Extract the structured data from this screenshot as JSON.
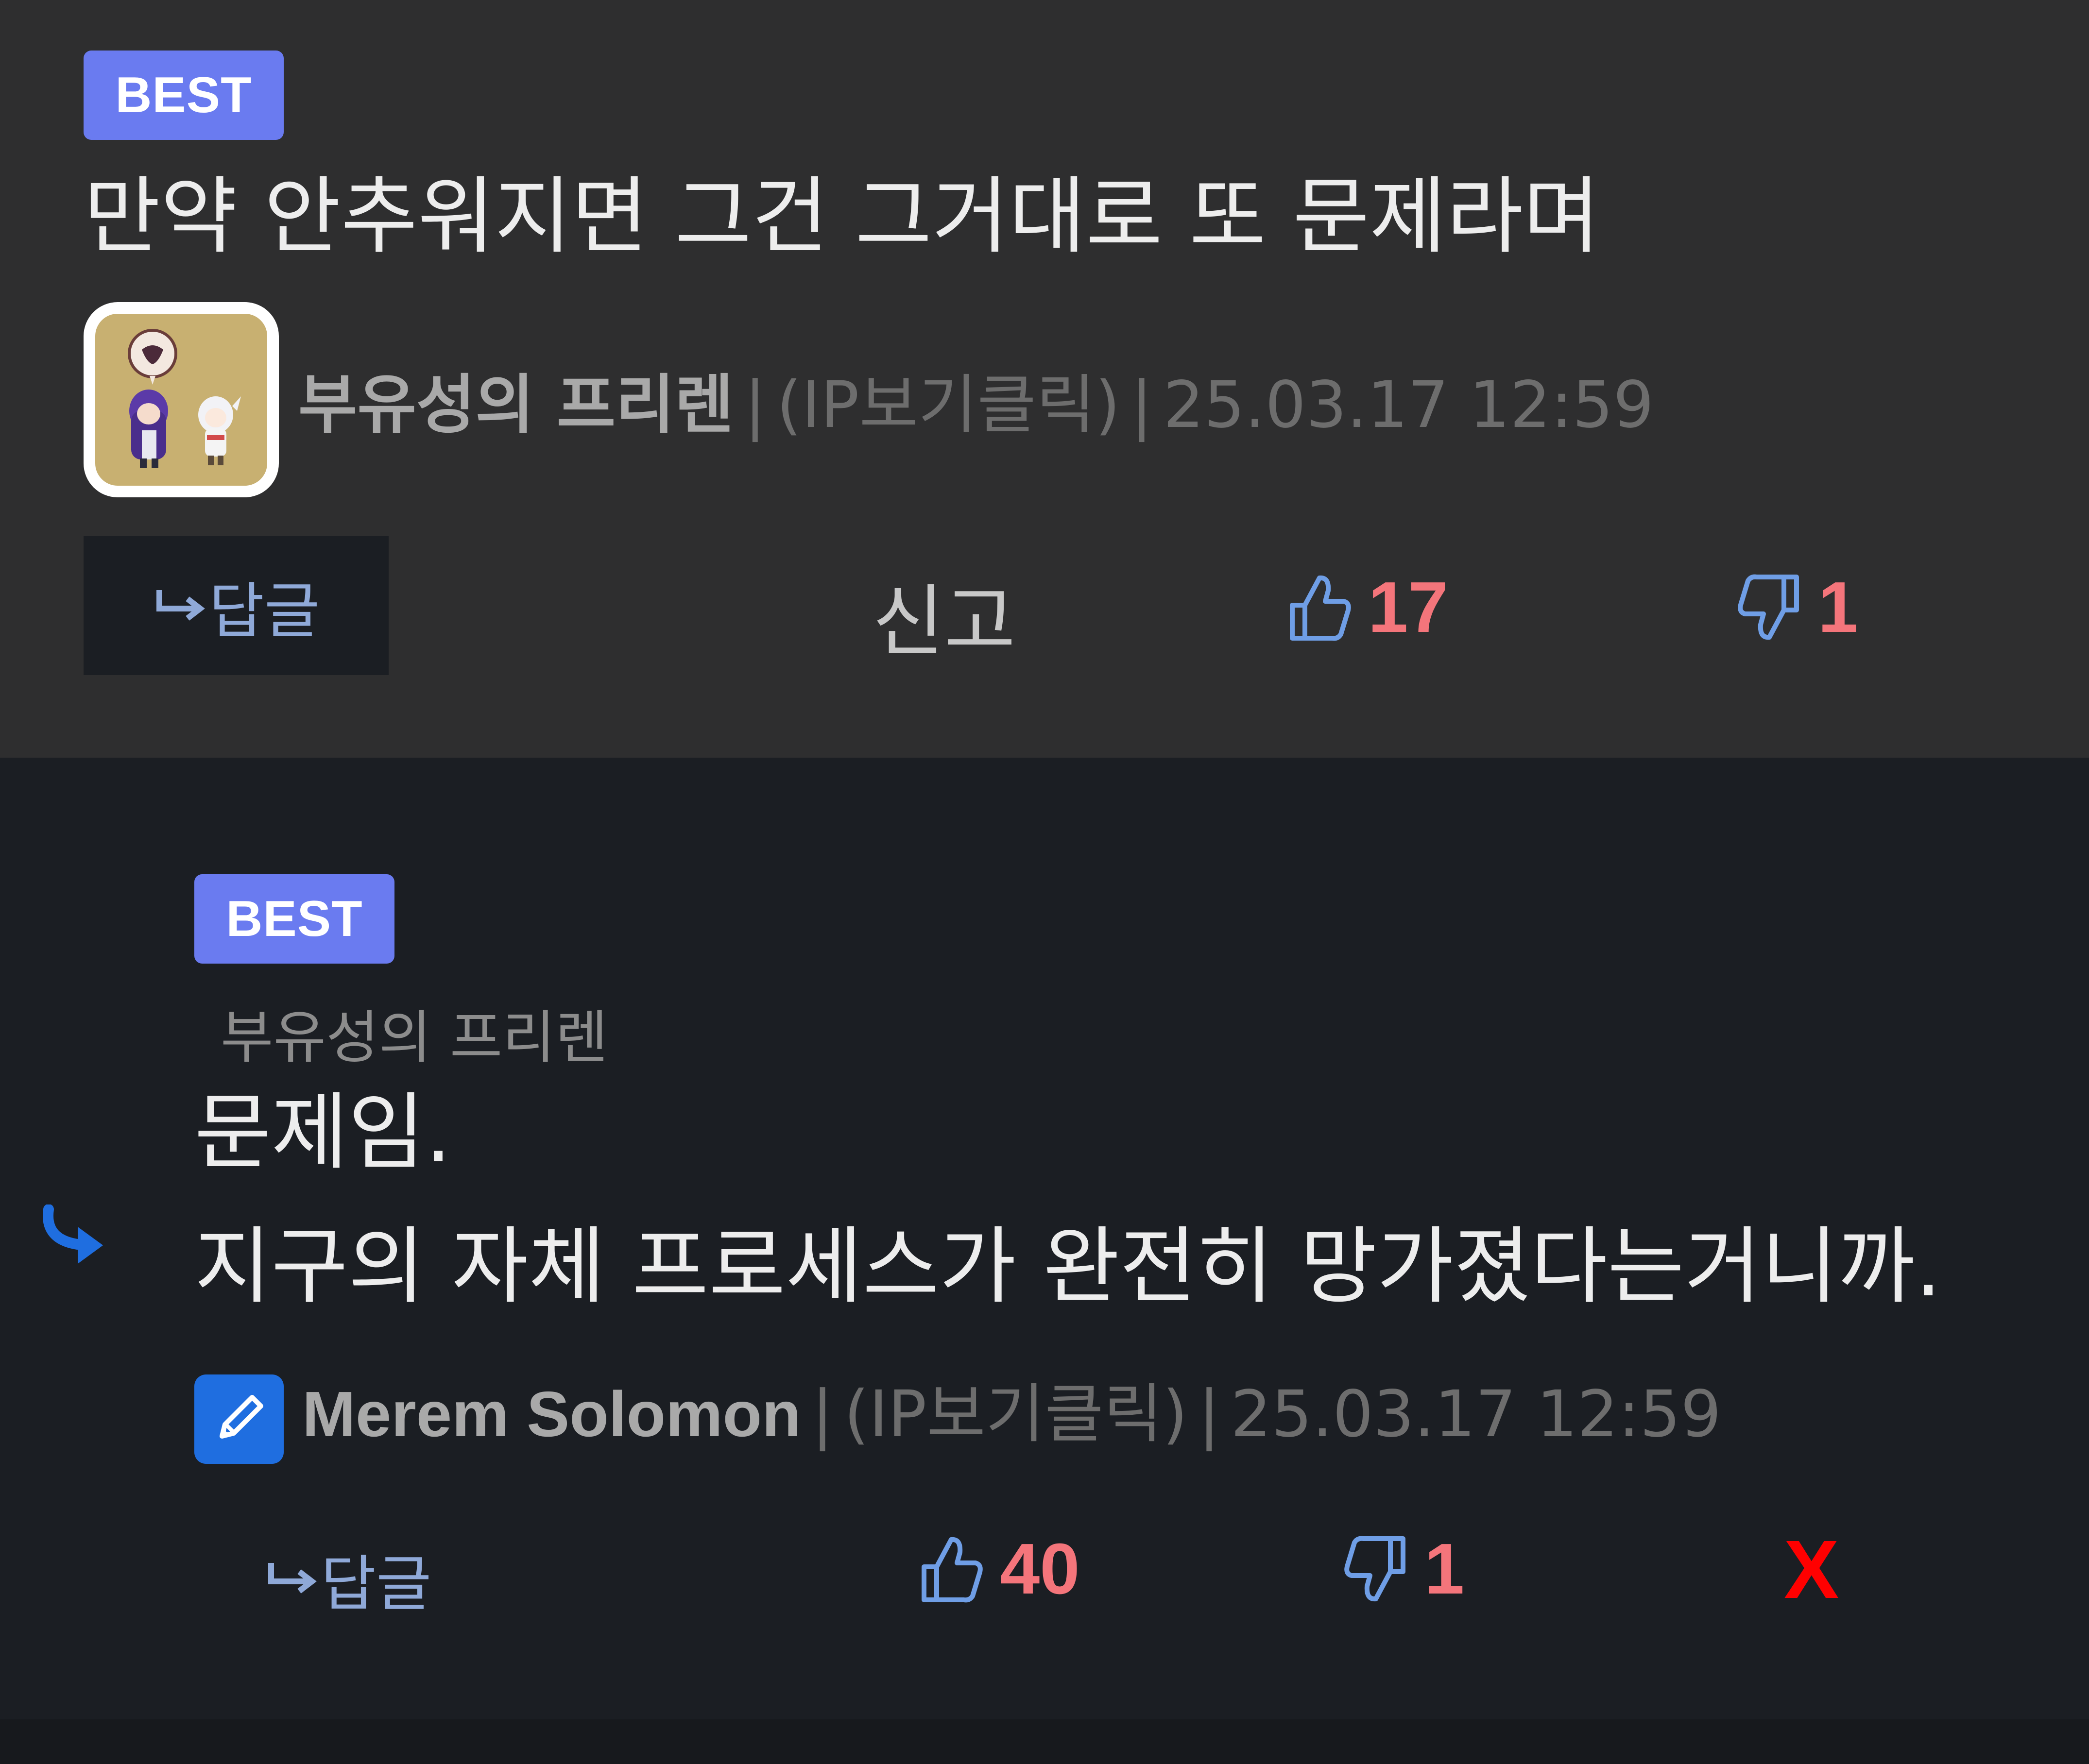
{
  "comments": [
    {
      "badge": "BEST",
      "text": "만약 안추워지면 그건 그거대로 또 문제라며",
      "nickname": "부유성의 프리렌",
      "separator": "|",
      "ip": "(IP보기클릭)",
      "datetime": "25.03.17 12:59",
      "reply_label": "답글",
      "report_label": "신고",
      "likes": "17",
      "dislikes": "1",
      "avatar_icon": "character-pair-avatar"
    },
    {
      "badge": "BEST",
      "parent_nickname": "부유성의 프리렌",
      "text_lines": [
        "문제임.",
        "지구의 자체 프로세스가 완전히 망가졌다는거니까."
      ],
      "nickname": "Merem Solomon",
      "separator": "|",
      "ip": "(IP보기클릭)",
      "datetime": "25.03.17 12:59",
      "reply_label": "답글",
      "likes": "40",
      "dislikes": "1",
      "delete_label": "X",
      "avatar_icon": "pencil-icon"
    }
  ],
  "icons": {
    "reply_arrow": "↳",
    "thumbs_up": "thumbs-up-icon",
    "thumbs_down": "thumbs-down-icon",
    "nested_reply": "reply-arrow-icon"
  },
  "colors": {
    "badge": "#6a7bf0",
    "count": "#f4757b",
    "thumb": "#6f9ee6",
    "delete": "#ff0000",
    "pencil_bg": "#1f6ee0"
  }
}
